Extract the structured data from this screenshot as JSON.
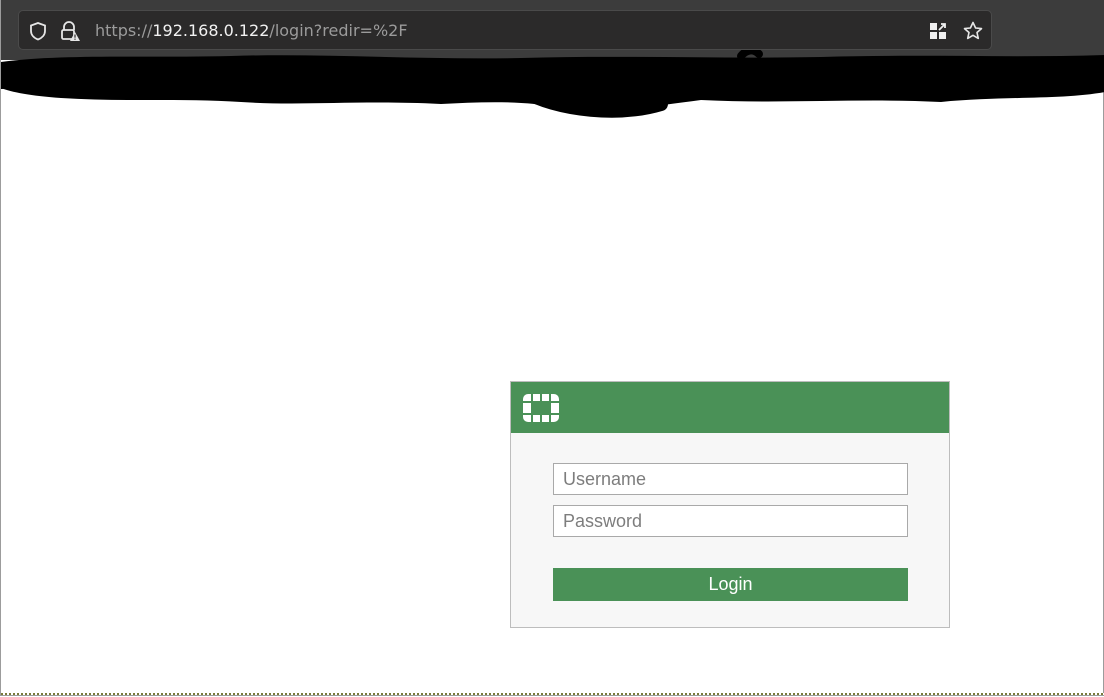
{
  "browser": {
    "url_scheme": "https://",
    "url_host": "192.168.0.122",
    "url_path": "/login?redir=%2F",
    "icons": [
      "shield-icon",
      "lock-warning-icon",
      "qr-grid-icon",
      "bookmark-star-icon"
    ]
  },
  "login": {
    "username_placeholder": "Username",
    "password_placeholder": "Password",
    "login_label": "Login",
    "logo_icon": "fortinet-logo-icon"
  },
  "colors": {
    "toolbar": "#3c3c3c",
    "urlbar": "#2b2a2a",
    "accent_green": "#4a9157",
    "card_bg": "#f7f7f7"
  }
}
